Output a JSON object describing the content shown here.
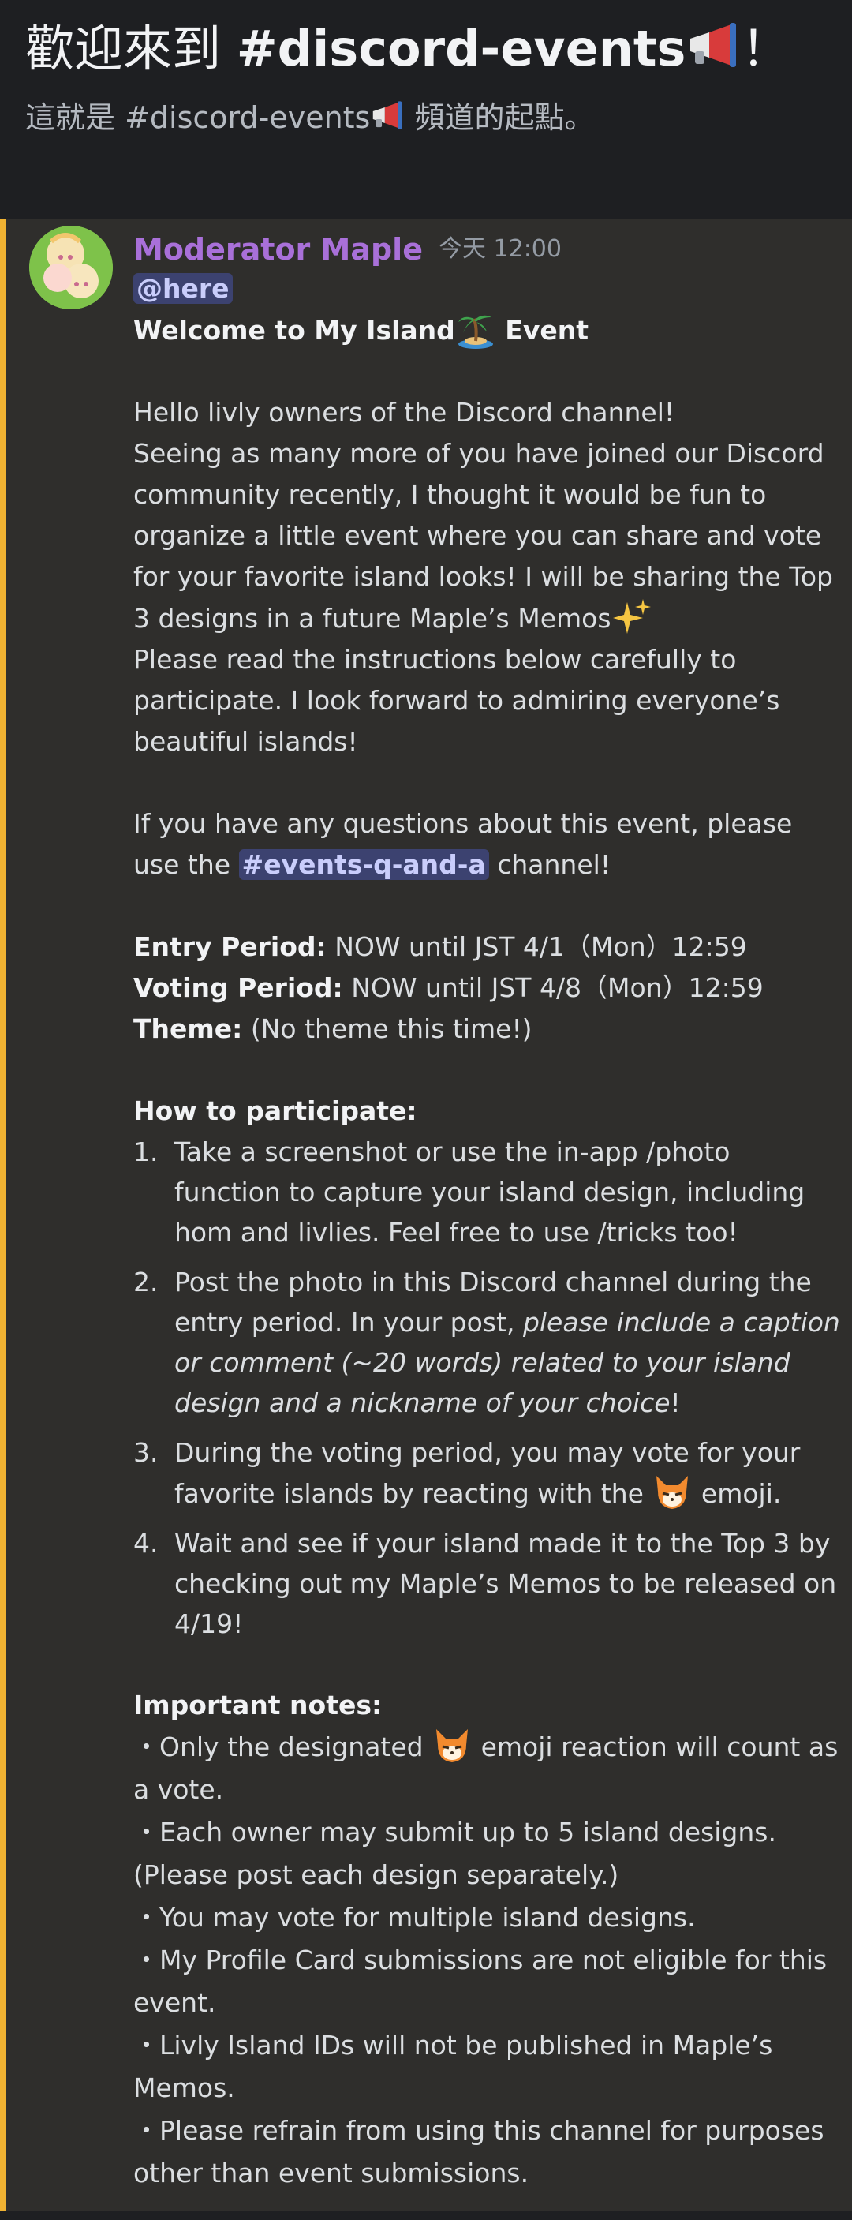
{
  "header": {
    "title_prefix": "歡迎來到 ",
    "title_channel": "#discord-events",
    "title_suffix": "！",
    "subtitle_prefix": "這就是 #discord-events",
    "subtitle_suffix": " 頻道的起點。"
  },
  "message": {
    "author": "Moderator Maple",
    "timestamp": "今天 12:00",
    "mention": "@here",
    "heading_prefix": "Welcome to My Island",
    "heading_suffix": " Event",
    "intro_1": "Hello livly owners of the Discord channel!",
    "intro_2": "Seeing as many more of you have joined our Discord community recently, I thought it would be fun to organize a little event where you can share and vote for your favorite island looks! I will be sharing the Top 3 designs in a future Maple’s Memos",
    "intro_3": "Please read the instructions below carefully to participate. I look forward to admiring everyone’s beautiful islands!",
    "questions_prefix": "If you have any questions about this event, please use the ",
    "questions_channel": "#events-q-and-a",
    "questions_suffix": " channel!",
    "entry_label": "Entry Period:",
    "entry_value": " NOW until JST 4/1（Mon）12:59",
    "voting_label": "Voting Period:",
    "voting_value": " NOW until JST 4/8（Mon）12:59",
    "theme_label": "Theme:",
    "theme_value": " (No theme this time!)",
    "how_heading": "How to participate:",
    "steps": [
      {
        "num": "1.",
        "text": "Take a screenshot or use the in-app /photo function to capture your island design, including hom and livlies. Feel free to use /tricks too!"
      },
      {
        "num": "2.",
        "text_a": "Post the photo in this Discord channel during the entry period. In your post, ",
        "text_italic": "please include a caption or comment (~20 words) related to your island design and a nickname of your choice",
        "text_b": "!"
      },
      {
        "num": "3.",
        "text_a": "During the voting period, you may vote for your favorite islands by reacting with the ",
        "text_b": " emoji."
      },
      {
        "num": "4.",
        "text": "Wait and see if your island made it to the Top 3 by checking out my Maple’s Memos to be released on 4/19!"
      }
    ],
    "notes_heading": "Important notes:",
    "note_1_a": "・Only the designated ",
    "note_1_b": " emoji reaction will count as a vote.",
    "note_2": "・Each owner may submit up to 5 island designs. (Please post each design separately.)",
    "note_3": "・You may vote for multiple island designs.",
    "note_4": "・My Profile Card submissions are not eligible for this event.",
    "note_5": "・Livly Island IDs will not be published in Maple’s Memos.",
    "note_6": "・Please refrain from using this channel for purposes other than event submissions."
  },
  "icons": {
    "megaphone": "megaphone-icon",
    "palm": "palm-island-icon",
    "sparkles": "sparkles-icon",
    "vote": "fox-vote-emoji"
  },
  "colors": {
    "accent_bar": "#f0b232",
    "author": "#a970d9",
    "mention_bg": "#3c4270"
  }
}
